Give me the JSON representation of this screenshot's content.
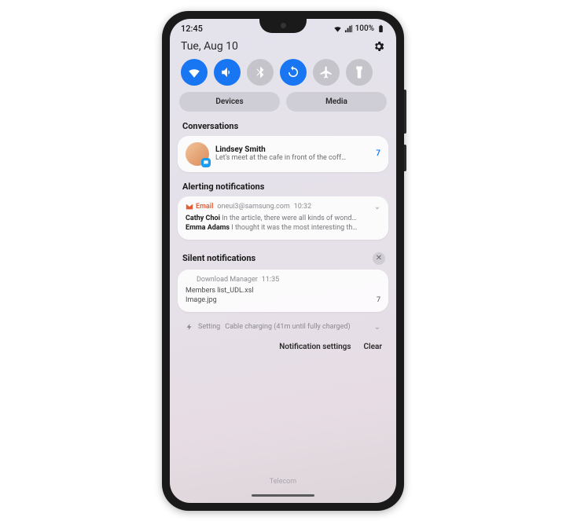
{
  "statusbar": {
    "time": "12:45",
    "battery_text": "100%"
  },
  "date": "Tue, Aug 10",
  "quick_settings": [
    {
      "name": "wifi",
      "on": true
    },
    {
      "name": "sound",
      "on": true
    },
    {
      "name": "bluetooth",
      "on": false
    },
    {
      "name": "rotate",
      "on": true
    },
    {
      "name": "airplane",
      "on": false
    },
    {
      "name": "flashlight",
      "on": false
    }
  ],
  "device_media": {
    "devices": "Devices",
    "media": "Media"
  },
  "sections": {
    "conversations": "Conversations",
    "alerting": "Alerting notifications",
    "silent": "Silent notifications"
  },
  "conversation": {
    "name": "Lindsey Smith",
    "message": "Let's meet at the cafe in front of the coff…",
    "count": "7"
  },
  "email": {
    "app": "Email",
    "account": "oneui3@samsung.com",
    "time": "10:32",
    "items": [
      {
        "sender": "Cathy Choi",
        "preview": "In the article, there were all kinds of wond…"
      },
      {
        "sender": "Emma Adams",
        "preview": "I thought it was the most interesting th…"
      }
    ]
  },
  "download": {
    "app": "Download Manager",
    "time": "11:35",
    "files": [
      {
        "name": "Members list_UDL.xsl",
        "count": ""
      },
      {
        "name": "Image.jpg",
        "count": "7"
      }
    ]
  },
  "setting_row": {
    "app": "Setting",
    "text": "Cable charging (41m until fully charged)"
  },
  "footer": {
    "settings": "Notification settings",
    "clear": "Clear"
  },
  "carrier": "Telecom"
}
